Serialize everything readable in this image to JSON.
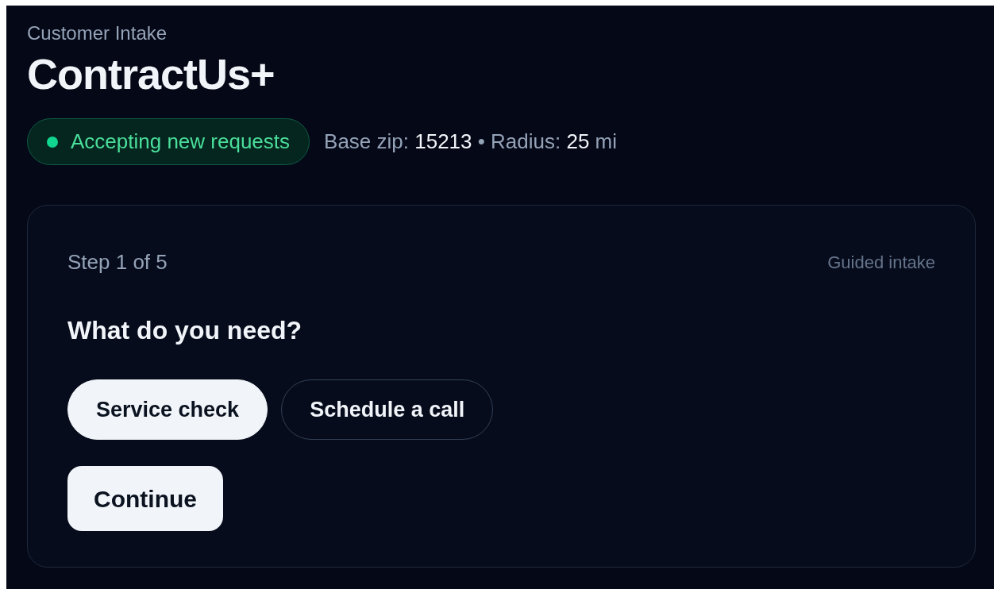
{
  "header": {
    "eyebrow": "Customer Intake",
    "title": "ContractUs+"
  },
  "status": {
    "label": "Accepting new requests",
    "color": "#10d68f"
  },
  "meta": [
    {
      "text": "Base zip: ",
      "strong": false
    },
    {
      "text": "15213",
      "strong": true
    },
    {
      "text": " • Radius: ",
      "strong": false
    },
    {
      "text": "25",
      "strong": true
    },
    {
      "text": " mi",
      "strong": false
    }
  ],
  "card": {
    "step": "Step 1 of 5",
    "mode": "Guided intake",
    "question": "What do you need?",
    "options": [
      {
        "label": "Service check",
        "selected": true
      },
      {
        "label": "Schedule a call",
        "selected": false
      }
    ],
    "primary_button": "Continue"
  }
}
